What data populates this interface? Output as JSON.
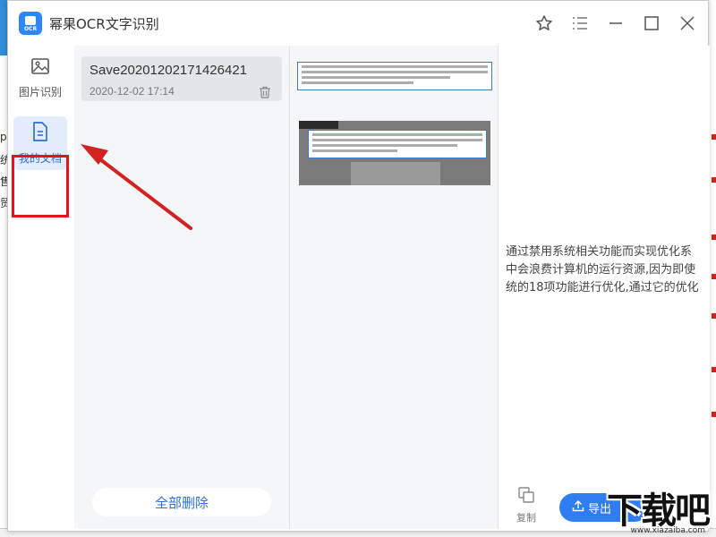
{
  "window": {
    "title": "幂果OCR文字识别",
    "icon_text": "OCR"
  },
  "titlebar_buttons": [
    "star-icon",
    "menu-icon",
    "minimize-icon",
    "maximize-icon",
    "close-icon"
  ],
  "sidebar": {
    "items": [
      {
        "label": "图片识别",
        "icon": "image-icon",
        "active": false
      },
      {
        "label": "我的文档",
        "icon": "document-icon",
        "active": true
      }
    ]
  },
  "document_list": {
    "items": [
      {
        "name": "Save20201202171426421",
        "date": "2020-12-02 17:14"
      }
    ],
    "delete_all_label": "全部删除"
  },
  "result": {
    "lines": [
      "通过禁用系统相关功能而实现优化系",
      "中会浪费计算机的运行资源,因为即使",
      "统的18项功能进行优化,通过它的优化"
    ],
    "copy_label": "复制",
    "export_label": "导出"
  },
  "background": {
    "left_chars": [
      "p",
      "统",
      "售",
      "贸"
    ]
  },
  "watermark": {
    "text": "下载吧",
    "url": "www.xiazaiba.com"
  },
  "colors": {
    "accent": "#2f6fd6",
    "highlight": "#e0141b",
    "export_bg": "#2f7df0"
  }
}
